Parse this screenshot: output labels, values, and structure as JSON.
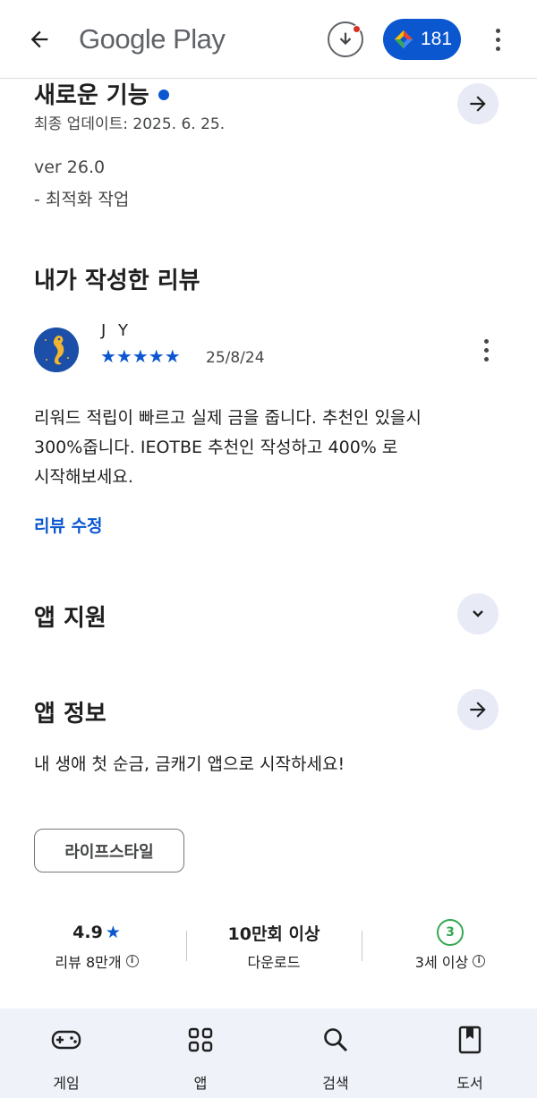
{
  "header": {
    "brand": "Google Play",
    "points": "181"
  },
  "whats_new": {
    "title": "새로운 기능",
    "updated": "최종 업데이트: 2025. 6. 25.",
    "version": "ver 26.0",
    "notes": "- 최적화 작업"
  },
  "my_review": {
    "title": "내가 작성한 리뷰",
    "reviewer": "J Y",
    "rating": 5,
    "stars": "★★★★★",
    "date": "25/8/24",
    "text_line1": "리워드 적립이 빠르고 실제 금을 줍니다. 추천인 있을시",
    "text_line2": "300%줍니다. IEOTBE 추천인 작성하고 400% 로",
    "text_line3": "시작해보세요.",
    "edit_label": "리뷰 수정"
  },
  "app_support": {
    "title": "앱 지원"
  },
  "app_info": {
    "title": "앱 정보",
    "description": "내 생애 첫 순금, 금캐기 앱으로 시작하세요!",
    "category": "라이프스타일"
  },
  "stats": {
    "rating": "4.9",
    "rating_star": "★",
    "reviews": "리뷰 8만개",
    "downloads": "10만회 이상",
    "downloads_label": "다운로드",
    "age_rating": "3",
    "age_label": "3세 이상"
  },
  "bottom_nav": {
    "games": "게임",
    "apps": "앱",
    "search": "검색",
    "books": "도서"
  },
  "colors": {
    "accent": "#0b57d0",
    "age_green": "#34a853",
    "nav_bg": "#eff2f9"
  }
}
